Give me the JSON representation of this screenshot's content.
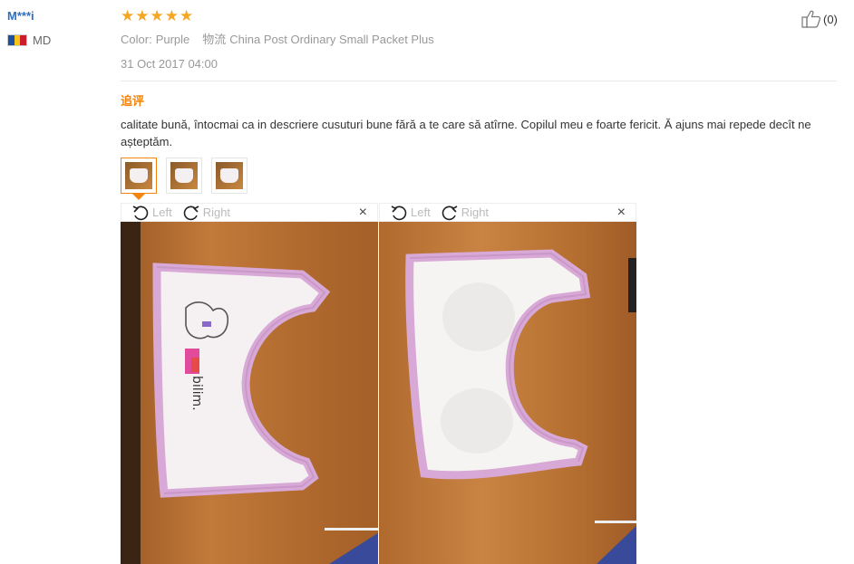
{
  "reviewer": {
    "name": "M***i",
    "country": "MD"
  },
  "rating": {
    "stars": 5
  },
  "attributes": {
    "color_label": "Color:",
    "color_value": "Purple",
    "shipping_label": "物流",
    "shipping_value": "China Post Ordinary Small Packet Plus"
  },
  "date": "31 Oct 2017 04:00",
  "helpful": {
    "count": "(0)"
  },
  "followup": {
    "label": "追评",
    "text": "calitate bună, întocmai ca in descriere cusuturi bune fără a te care să atîrne. Copilul meu e foarte fericit. Ă ajuns mai repede decît ne așteptăm."
  },
  "thumbnails": {
    "count": 3,
    "active_index": 0
  },
  "viewers": [
    {
      "rotate_left": "Left",
      "rotate_right": "Right",
      "close": "×"
    },
    {
      "rotate_left": "Left",
      "rotate_right": "Right",
      "close": "×"
    }
  ],
  "colors": {
    "accent": "#f2840f",
    "star": "#f5a623",
    "link": "#2f6fbf",
    "wood": "#b56f30",
    "trim": "#d8a9d6"
  },
  "icons": [
    "thumbs-up-icon",
    "rotate-left-icon",
    "rotate-right-icon",
    "close-icon",
    "star-icon",
    "flag-moldova-icon"
  ]
}
